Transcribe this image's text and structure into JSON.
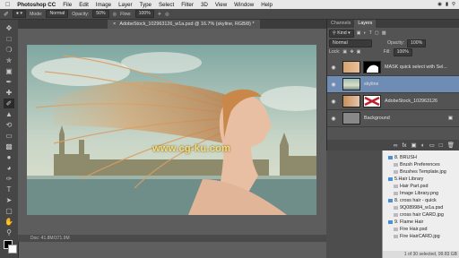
{
  "menubar": {
    "app_name": "Photoshop CC",
    "items": [
      "File",
      "Edit",
      "Image",
      "Layer",
      "Type",
      "Select",
      "Filter",
      "3D",
      "View",
      "Window",
      "Help"
    ]
  },
  "options": {
    "mode_label": "Mode:",
    "mode_value": "Normal",
    "opacity_label": "Opacity:",
    "opacity_value": "50%",
    "flow_label": "Flow:",
    "flow_value": "100%"
  },
  "document_tab": {
    "title": "AdobeStock_102963126_w1a.psd @ 16.7% (skyline, RGB/8) *"
  },
  "status": {
    "doc_size": "Doc: 41.8M/371.9M"
  },
  "layers_panel": {
    "tabs": [
      "Channels",
      "Layers"
    ],
    "kind_label": "Kind",
    "blend_mode": "Normal",
    "opacity_label": "Opacity:",
    "opacity_value": "100%",
    "lock_label": "Lock:",
    "fill_label": "Fill:",
    "fill_value": "100%",
    "layers": [
      {
        "name": "MASK quick select with Sel...",
        "selected": false
      },
      {
        "name": "skyline",
        "selected": true
      },
      {
        "name": "AdobeStock_102963126",
        "selected": false
      },
      {
        "name": "Background",
        "selected": false
      }
    ]
  },
  "libraries": {
    "items": [
      {
        "label": "8. BRUSH",
        "type": "lib"
      },
      {
        "label": "Brush Preferences",
        "type": "file"
      },
      {
        "label": "Brushes Template.jpg",
        "type": "file"
      },
      {
        "label": "5.Hair Library",
        "type": "lib"
      },
      {
        "label": "Hair Part.psd",
        "type": "file"
      },
      {
        "label": "Image Library.png",
        "type": "file"
      },
      {
        "label": "8. cross hair - quick",
        "type": "lib"
      },
      {
        "label": "9Q089984_w1a.psd",
        "type": "file"
      },
      {
        "label": "cross hair CARD.jpg",
        "type": "file"
      },
      {
        "label": "9. Flame Hair",
        "type": "lib"
      },
      {
        "label": "Fire Hair.psd",
        "type": "file"
      },
      {
        "label": "Fire HairCARD.jpg",
        "type": "file"
      }
    ],
    "footer": "1 of 30 selected, 99.83 GB"
  },
  "watermark": "www.cg-ku.com",
  "colors": {
    "selected_layer": "#6f8cb4",
    "panel_bg": "#535353",
    "toolbar_bg": "#464646"
  }
}
